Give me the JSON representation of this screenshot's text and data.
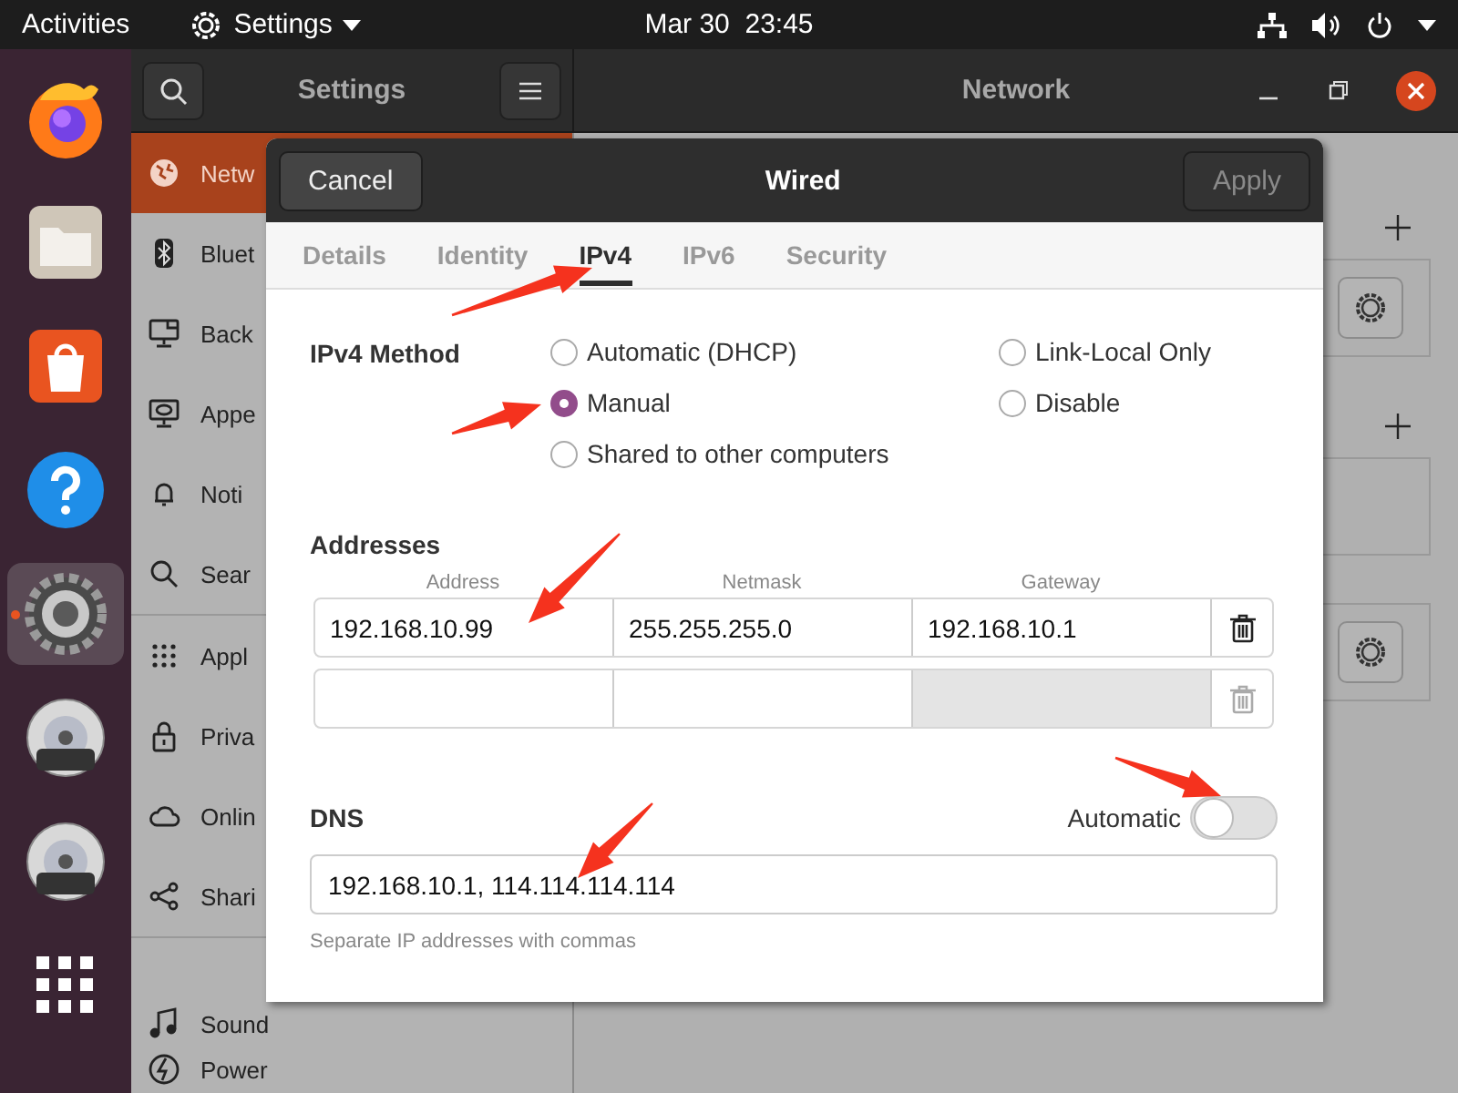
{
  "top_bar": {
    "activities": "Activities",
    "app_menu": "Settings",
    "clock": "Mar 30  23:45"
  },
  "dock": [
    {
      "kind": "browser",
      "running": false
    },
    {
      "kind": "files",
      "running": false
    },
    {
      "kind": "store",
      "running": false
    },
    {
      "kind": "help",
      "running": false
    },
    {
      "kind": "settings",
      "running": true
    },
    {
      "kind": "disc",
      "running": false
    },
    {
      "kind": "disc",
      "running": false
    },
    {
      "kind": "apps",
      "running": false
    }
  ],
  "settings_window": {
    "sidebar_title": "Settings",
    "page_title": "Network"
  },
  "sidebar": {
    "items": [
      {
        "label": "Netw",
        "kind": "globe",
        "selected": true
      },
      {
        "label": "Bluet",
        "kind": "bluetooth",
        "selected": false
      },
      {
        "label": "Back",
        "kind": "display",
        "selected": false
      },
      {
        "label": "Appe",
        "kind": "appearance",
        "selected": false
      },
      {
        "label": "Noti",
        "kind": "bell",
        "selected": false
      },
      {
        "label": "Sear",
        "kind": "search",
        "selected": false,
        "divider_after": true
      },
      {
        "label": "Appl",
        "kind": "grid",
        "selected": false
      },
      {
        "label": "Priva",
        "kind": "lock",
        "selected": false
      },
      {
        "label": "Onlin",
        "kind": "cloud",
        "selected": false
      },
      {
        "label": "Shari",
        "kind": "share",
        "selected": false,
        "divider_after": true
      },
      {
        "label": "Sound",
        "kind": "music",
        "selected": false
      },
      {
        "label": "Power",
        "kind": "power",
        "selected": false
      }
    ]
  },
  "network_sections": [
    {
      "kind": "device_card"
    },
    {
      "kind": "empty_card"
    },
    {
      "kind": "device_card"
    }
  ],
  "dialog": {
    "title": "Wired",
    "cancel": "Cancel",
    "apply": "Apply",
    "apply_disabled": true,
    "tabs": [
      {
        "label": "Details",
        "selected": false
      },
      {
        "label": "Identity",
        "selected": false
      },
      {
        "label": "IPv4",
        "selected": true
      },
      {
        "label": "IPv6",
        "selected": false
      },
      {
        "label": "Security",
        "selected": false
      }
    ],
    "method": {
      "label": "IPv4 Method",
      "options": [
        {
          "label": "Automatic (DHCP)",
          "selected": false
        },
        {
          "label": "Manual",
          "selected": true
        },
        {
          "label": "Shared to other computers",
          "selected": false
        },
        {
          "label": "Link-Local Only",
          "selected": false
        },
        {
          "label": "Disable",
          "selected": false
        }
      ]
    },
    "addresses": {
      "title": "Addresses",
      "columns": [
        "Address",
        "Netmask",
        "Gateway"
      ],
      "rows": [
        {
          "cells": [
            {
              "value": "192.168.10.99",
              "disabled": false
            },
            {
              "value": "255.255.255.0",
              "disabled": false
            },
            {
              "value": "192.168.10.1",
              "disabled": false
            }
          ],
          "removable": true
        },
        {
          "cells": [
            {
              "disabled": false
            },
            {
              "disabled": false
            },
            {
              "disabled": true
            }
          ],
          "removable": false
        }
      ]
    },
    "dns": {
      "title": "DNS",
      "automatic_label": "Automatic",
      "automatic_on": false,
      "value": "192.168.10.1, 114.114.114.114",
      "hint": "Separate IP addresses with commas"
    }
  }
}
